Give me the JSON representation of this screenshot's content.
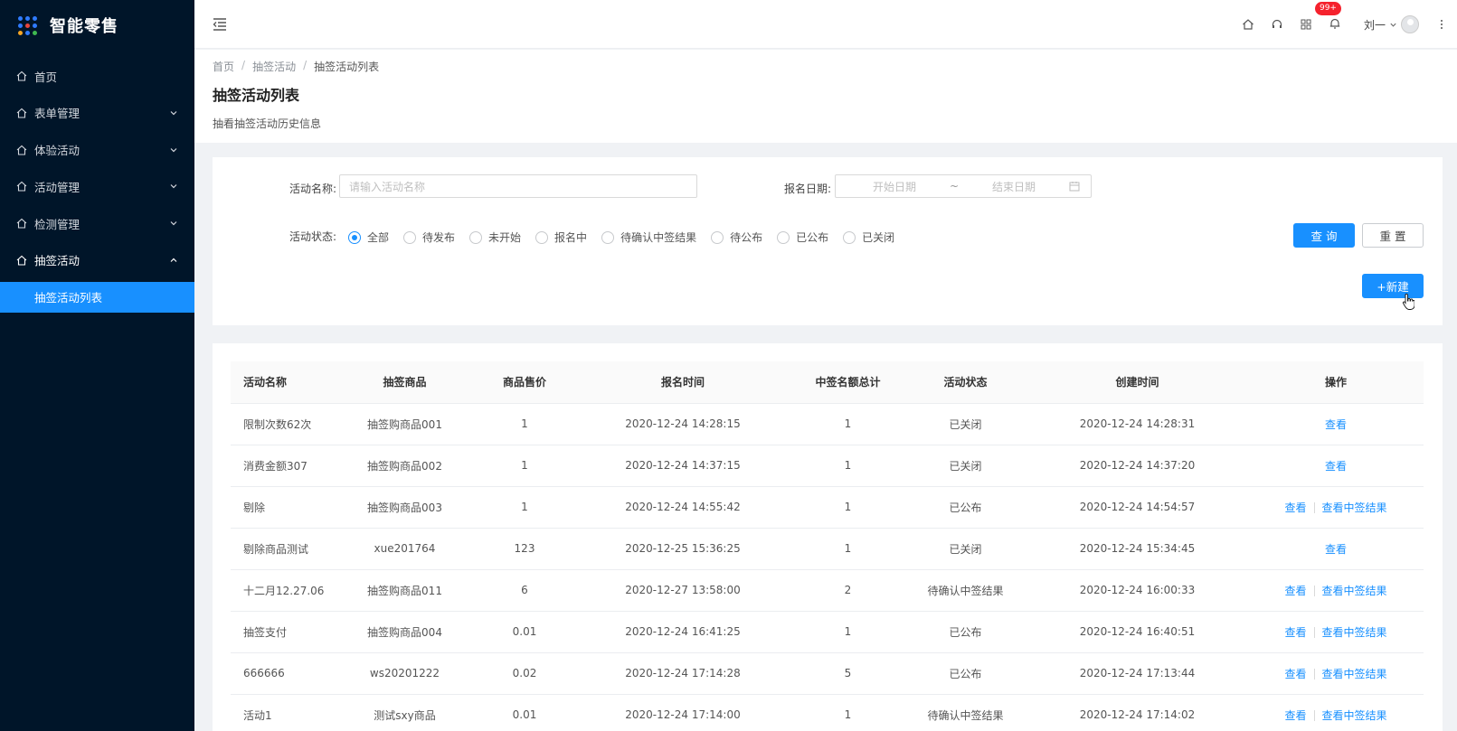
{
  "app": {
    "title": "智能零售"
  },
  "sidebar": {
    "items": [
      {
        "label": "首页",
        "has_children": false
      },
      {
        "label": "表单管理",
        "has_children": true
      },
      {
        "label": "体验活动",
        "has_children": true
      },
      {
        "label": "活动管理",
        "has_children": true
      },
      {
        "label": "检测管理",
        "has_children": true
      },
      {
        "label": "抽签活动",
        "has_children": true,
        "open": true
      }
    ],
    "sub_item": "抽签活动列表"
  },
  "header": {
    "notification_badge": "99+",
    "user_name": "刘一"
  },
  "breadcrumb": [
    "首页",
    "抽签活动",
    "抽签活动列表"
  ],
  "page": {
    "title": "抽签活动列表",
    "description": "抽看抽签活动历史信息"
  },
  "filter": {
    "name_label": "活动名称:",
    "name_placeholder": "请输入活动名称",
    "date_label": "报名日期:",
    "date_start_placeholder": "开始日期",
    "date_separator": "~",
    "date_end_placeholder": "结束日期",
    "status_label": "活动状态:",
    "status_options": [
      "全部",
      "待发布",
      "未开始",
      "报名中",
      "待确认中签结果",
      "待公布",
      "已公布",
      "已关闭"
    ],
    "selected_status": "全部",
    "query_label": "查 询",
    "reset_label": "重 置",
    "new_label": "+新建"
  },
  "table": {
    "columns": [
      "活动名称",
      "抽签商品",
      "商品售价",
      "报名时间",
      "中签名额总计",
      "活动状态",
      "创建时间",
      "操作"
    ],
    "view_label": "查看",
    "result_label": "查看中签结果",
    "rows": [
      {
        "name": "限制次数62次",
        "product": "抽签购商品001",
        "price": "1",
        "signup_time": "2020-12-24 14:28:15",
        "quota": "1",
        "status": "已关闭",
        "created": "2020-12-24 14:28:31",
        "has_result": false
      },
      {
        "name": "消费金额307",
        "product": "抽签购商品002",
        "price": "1",
        "signup_time": "2020-12-24 14:37:15",
        "quota": "1",
        "status": "已关闭",
        "created": "2020-12-24 14:37:20",
        "has_result": false
      },
      {
        "name": "剔除",
        "product": "抽签购商品003",
        "price": "1",
        "signup_time": "2020-12-24 14:55:42",
        "quota": "1",
        "status": "已公布",
        "created": "2020-12-24 14:54:57",
        "has_result": true
      },
      {
        "name": "剔除商品测试",
        "product": "xue201764",
        "price": "123",
        "signup_time": "2020-12-25 15:36:25",
        "quota": "1",
        "status": "已关闭",
        "created": "2020-12-24 15:34:45",
        "has_result": false
      },
      {
        "name": "十二月12.27.06",
        "product": "抽签购商品011",
        "price": "6",
        "signup_time": "2020-12-27 13:58:00",
        "quota": "2",
        "status": "待确认中签结果",
        "created": "2020-12-24 16:00:33",
        "has_result": true
      },
      {
        "name": "抽签支付",
        "product": "抽签购商品004",
        "price": "0.01",
        "signup_time": "2020-12-24 16:41:25",
        "quota": "1",
        "status": "已公布",
        "created": "2020-12-24 16:40:51",
        "has_result": true
      },
      {
        "name": "666666",
        "product": "ws20201222",
        "price": "0.02",
        "signup_time": "2020-12-24 17:14:28",
        "quota": "5",
        "status": "已公布",
        "created": "2020-12-24 17:13:44",
        "has_result": true
      },
      {
        "name": "活动1",
        "product": "测试sxy商品",
        "price": "0.01",
        "signup_time": "2020-12-24 17:14:00",
        "quota": "1",
        "status": "待确认中签结果",
        "created": "2020-12-24 17:14:02",
        "has_result": true
      }
    ]
  },
  "colors": {
    "sidebar_bg": "#001529",
    "accent": "#1890ff",
    "badge": "#f5222d"
  }
}
